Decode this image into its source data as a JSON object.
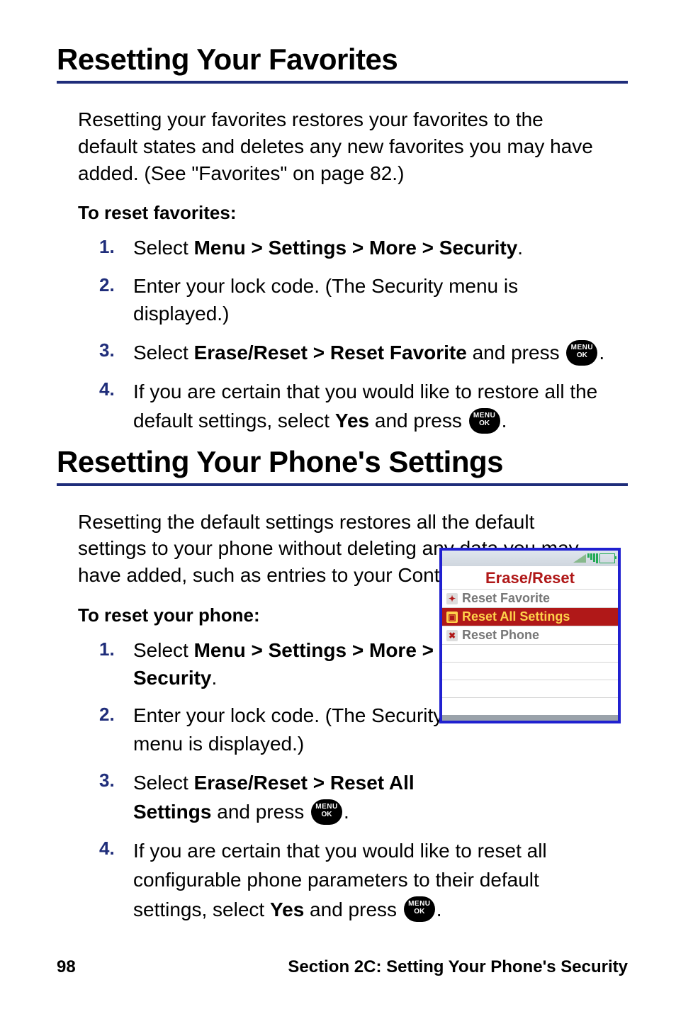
{
  "section1": {
    "title": "Resetting Your Favorites",
    "intro": "Resetting your favorites restores your favorites to the default states and deletes any new favorites you may have added. (See \"Favorites\" on page 82.)",
    "lead": "To reset favorites:",
    "steps": {
      "s1": {
        "num": "1.",
        "pre": "Select ",
        "bold": "Menu > Settings > More > Security",
        "post": "."
      },
      "s2": {
        "num": "2.",
        "text": "Enter your lock code. (The Security menu is displayed.)"
      },
      "s3": {
        "num": "3.",
        "pre": "Select ",
        "bold": "Erase/Reset > Reset Favorite",
        "mid": " and press ",
        "post": "."
      },
      "s4": {
        "num": "4.",
        "pre": "If you are certain that you would like to restore all the default settings, select ",
        "bold": "Yes",
        "mid": " and press ",
        "post": "."
      }
    }
  },
  "section2": {
    "title": "Resetting Your Phone's Settings",
    "intro": "Resetting the default settings restores all the default settings to your phone without deleting any data you may have added, such as entries to your Contacts list.",
    "lead": "To reset your phone:",
    "steps": {
      "s1": {
        "num": "1.",
        "pre": "Select ",
        "bold": "Menu > Settings > More > Security",
        "post": "."
      },
      "s2": {
        "num": "2.",
        "text": "Enter your lock code. (The Security menu is displayed.)"
      },
      "s3": {
        "num": "3.",
        "pre": "Select ",
        "bold": "Erase/Reset > Reset All Settings",
        "mid": " and press ",
        "post": "."
      },
      "s4": {
        "num": "4.",
        "pre": "If you are certain that you would like to reset all configurable phone parameters to their default settings, select ",
        "bold": "Yes",
        "mid": " and press ",
        "post": "."
      }
    }
  },
  "menuok": {
    "line1": "MENU",
    "line2": "OK"
  },
  "phone": {
    "title": "Erase/Reset",
    "items": {
      "i1": "Reset Favorite",
      "i2": "Reset All Settings",
      "i3": "Reset Phone"
    }
  },
  "footer": {
    "page": "98",
    "section": "Section 2C: Setting Your Phone's Security"
  }
}
